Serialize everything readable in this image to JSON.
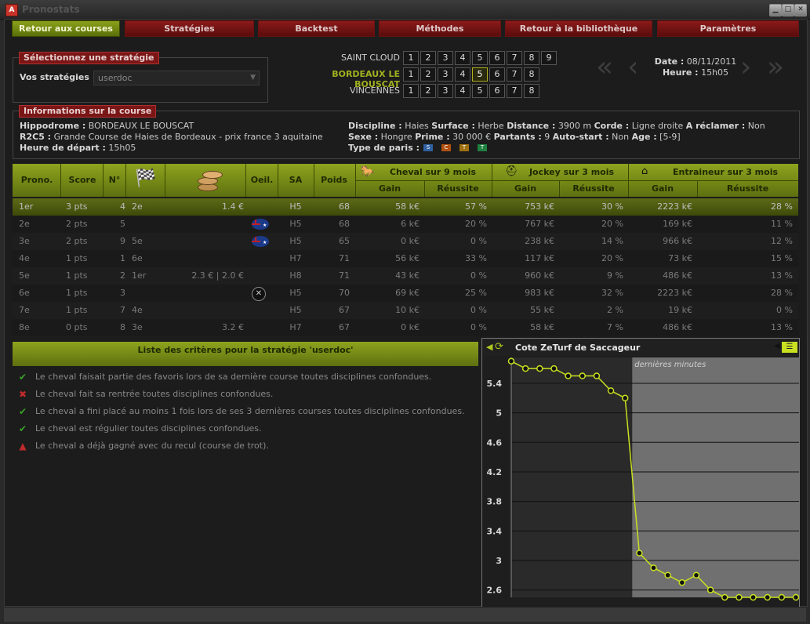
{
  "window": {
    "title": "Pronostats",
    "icon": "app-logo-icon"
  },
  "nav": [
    {
      "label": "Retour aux courses",
      "active": true
    },
    {
      "label": "Stratégies"
    },
    {
      "label": "Backtest"
    },
    {
      "label": "Méthodes"
    },
    {
      "label": "Retour à la bibliothèque"
    },
    {
      "label": "Paramètres"
    }
  ],
  "strategy": {
    "section_title": "Sélectionnez une stratégie",
    "label": "Vos stratégies",
    "selected": "userdoc"
  },
  "races": [
    {
      "name": "SAINT CLOUD",
      "numbers": [
        "1",
        "2",
        "3",
        "4",
        "5",
        "6",
        "7",
        "8",
        "9"
      ]
    },
    {
      "name": "BORDEAUX LE BOUSCAT",
      "numbers": [
        "1",
        "2",
        "3",
        "4",
        "5",
        "6",
        "7",
        "8"
      ],
      "selected": "5"
    },
    {
      "name": "VINCENNES",
      "numbers": [
        "1",
        "2",
        "3",
        "4",
        "5",
        "6",
        "7",
        "8"
      ]
    }
  ],
  "date_block": {
    "date_label": "Date :",
    "date": "08/11/2011",
    "time_label": "Heure :",
    "time": "15h05"
  },
  "info": {
    "section_title": "Informations sur la course",
    "hippodrome_label": "Hippodrome :",
    "hippodrome": "BORDEAUX LE BOUSCAT",
    "race_label": "R2C5 :",
    "race": "Grande Course de Haies de Bordeaux - prix france 3 aquitaine",
    "depart_label": "Heure de départ :",
    "depart": "15h05",
    "discipline_label": "Discipline :",
    "discipline": "Haies",
    "surface_label": "Surface :",
    "surface": "Herbe",
    "distance_label": "Distance :",
    "distance": "3900 m",
    "corde_label": "Corde :",
    "corde": "Ligne droite",
    "reclamer_label": "A réclamer :",
    "reclamer": "Non",
    "sexe_label": "Sexe :",
    "sexe": "Hongre",
    "prime_label": "Prime :",
    "prime": "30 000 €",
    "partants_label": "Partants :",
    "partants": "9",
    "autostart_label": "Auto-start :",
    "autostart": "Non",
    "age_label": "Age :",
    "age": "[5-9]",
    "paris_label": "Type de paris :",
    "paris": [
      {
        "code": "S",
        "color": "#3060a0"
      },
      {
        "code": "C",
        "color": "#b05010"
      },
      {
        "code": "T",
        "color": "#a07010"
      },
      {
        "code": "T",
        "color": "#208040"
      }
    ]
  },
  "table": {
    "headers": {
      "prono": "Prono.",
      "score": "Score",
      "num": "N°",
      "oeil": "Oeil.",
      "sa": "SA",
      "poids": "Poids",
      "cheval": "Cheval sur 9 mois",
      "jockey": "Jockey sur 3 mois",
      "entraineur": "Entraineur sur 3 mois",
      "gain": "Gain",
      "reussite": "Réussite"
    },
    "rows": [
      {
        "prono": "1er",
        "score": "3 pts",
        "num": "4",
        "music": "2e",
        "cote": "1.4 €",
        "oeil": "",
        "sa": "H5",
        "poids": "68",
        "cg": "58 k€",
        "cr": "57 %",
        "jg": "753 k€",
        "jr": "30 %",
        "eg": "2223 k€",
        "er": "28 %"
      },
      {
        "prono": "2e",
        "score": "2 pts",
        "num": "5",
        "music": "",
        "cote": "",
        "oeil": "flag",
        "sa": "H5",
        "poids": "68",
        "cg": "6 k€",
        "cr": "20 %",
        "jg": "767 k€",
        "jr": "20 %",
        "eg": "169 k€",
        "er": "11 %"
      },
      {
        "prono": "3e",
        "score": "2 pts",
        "num": "9",
        "music": "5e",
        "cote": "",
        "oeil": "flag",
        "sa": "H5",
        "poids": "65",
        "cg": "0 k€",
        "cr": "0 %",
        "jg": "238 k€",
        "jr": "14 %",
        "eg": "966 k€",
        "er": "12 %"
      },
      {
        "prono": "4e",
        "score": "1 pts",
        "num": "1",
        "music": "6e",
        "cote": "",
        "oeil": "",
        "sa": "H7",
        "poids": "71",
        "cg": "56 k€",
        "cr": "33 %",
        "jg": "117 k€",
        "jr": "20 %",
        "eg": "73 k€",
        "er": "15 %"
      },
      {
        "prono": "5e",
        "score": "1 pts",
        "num": "2",
        "music": "1er",
        "cote": "2.3 € | 2.0 €",
        "oeil": "",
        "sa": "H8",
        "poids": "71",
        "cg": "43 k€",
        "cr": "0 %",
        "jg": "960 k€",
        "jr": "9 %",
        "eg": "486 k€",
        "er": "13 %"
      },
      {
        "prono": "6e",
        "score": "1 pts",
        "num": "3",
        "music": "",
        "cote": "",
        "oeil": "x",
        "sa": "H5",
        "poids": "70",
        "cg": "69 k€",
        "cr": "25 %",
        "jg": "983 k€",
        "jr": "32 %",
        "eg": "2223 k€",
        "er": "28 %"
      },
      {
        "prono": "7e",
        "score": "1 pts",
        "num": "7",
        "music": "4e",
        "cote": "",
        "oeil": "",
        "sa": "H5",
        "poids": "67",
        "cg": "10 k€",
        "cr": "0 %",
        "jg": "55 k€",
        "jr": "2 %",
        "eg": "19 k€",
        "er": "0 %"
      },
      {
        "prono": "8e",
        "score": "0 pts",
        "num": "8",
        "music": "3e",
        "cote": "3.2 €",
        "oeil": "",
        "sa": "H7",
        "poids": "67",
        "cg": "0 k€",
        "cr": "0 %",
        "jg": "58 k€",
        "jr": "7 %",
        "eg": "486 k€",
        "er": "13 %"
      }
    ]
  },
  "criteria": {
    "title": "Liste des critères pour la stratégie 'userdoc'",
    "items": [
      {
        "status": "ok",
        "text": "Le cheval faisait partie des favoris lors de sa dernière course toutes disciplines confondues."
      },
      {
        "status": "fail",
        "text": "Le cheval fait sa rentrée toutes disciplines confondues."
      },
      {
        "status": "ok",
        "text": "Le cheval a fini placé au moins 1 fois lors de ses 3 dernières courses toutes disciplines confondues."
      },
      {
        "status": "ok",
        "text": "Le cheval est régulier toutes disciplines confondues."
      },
      {
        "status": "warn",
        "text": "Le cheval a déjà gagné avec du recul (course de trot)."
      }
    ]
  },
  "chart_data": {
    "type": "line",
    "title": "Cote ZeTurf de Saccageur",
    "annotation": "dernières minutes",
    "ylim": [
      2.5,
      5.75
    ],
    "yticks": [
      2.6,
      3,
      3.4,
      3.8,
      4.2,
      4.6,
      5,
      5.4
    ],
    "series": [
      {
        "values": [
          5.7,
          5.6,
          5.6,
          5.6,
          5.5,
          5.5,
          5.5,
          5.3,
          5.2,
          3.1,
          2.9,
          2.8,
          2.7,
          2.8,
          2.6,
          2.5,
          2.5,
          2.5,
          2.5,
          2.5,
          2.5
        ]
      }
    ],
    "grid": true,
    "line_color": "#c8e020",
    "highlight_from_index": 9
  }
}
